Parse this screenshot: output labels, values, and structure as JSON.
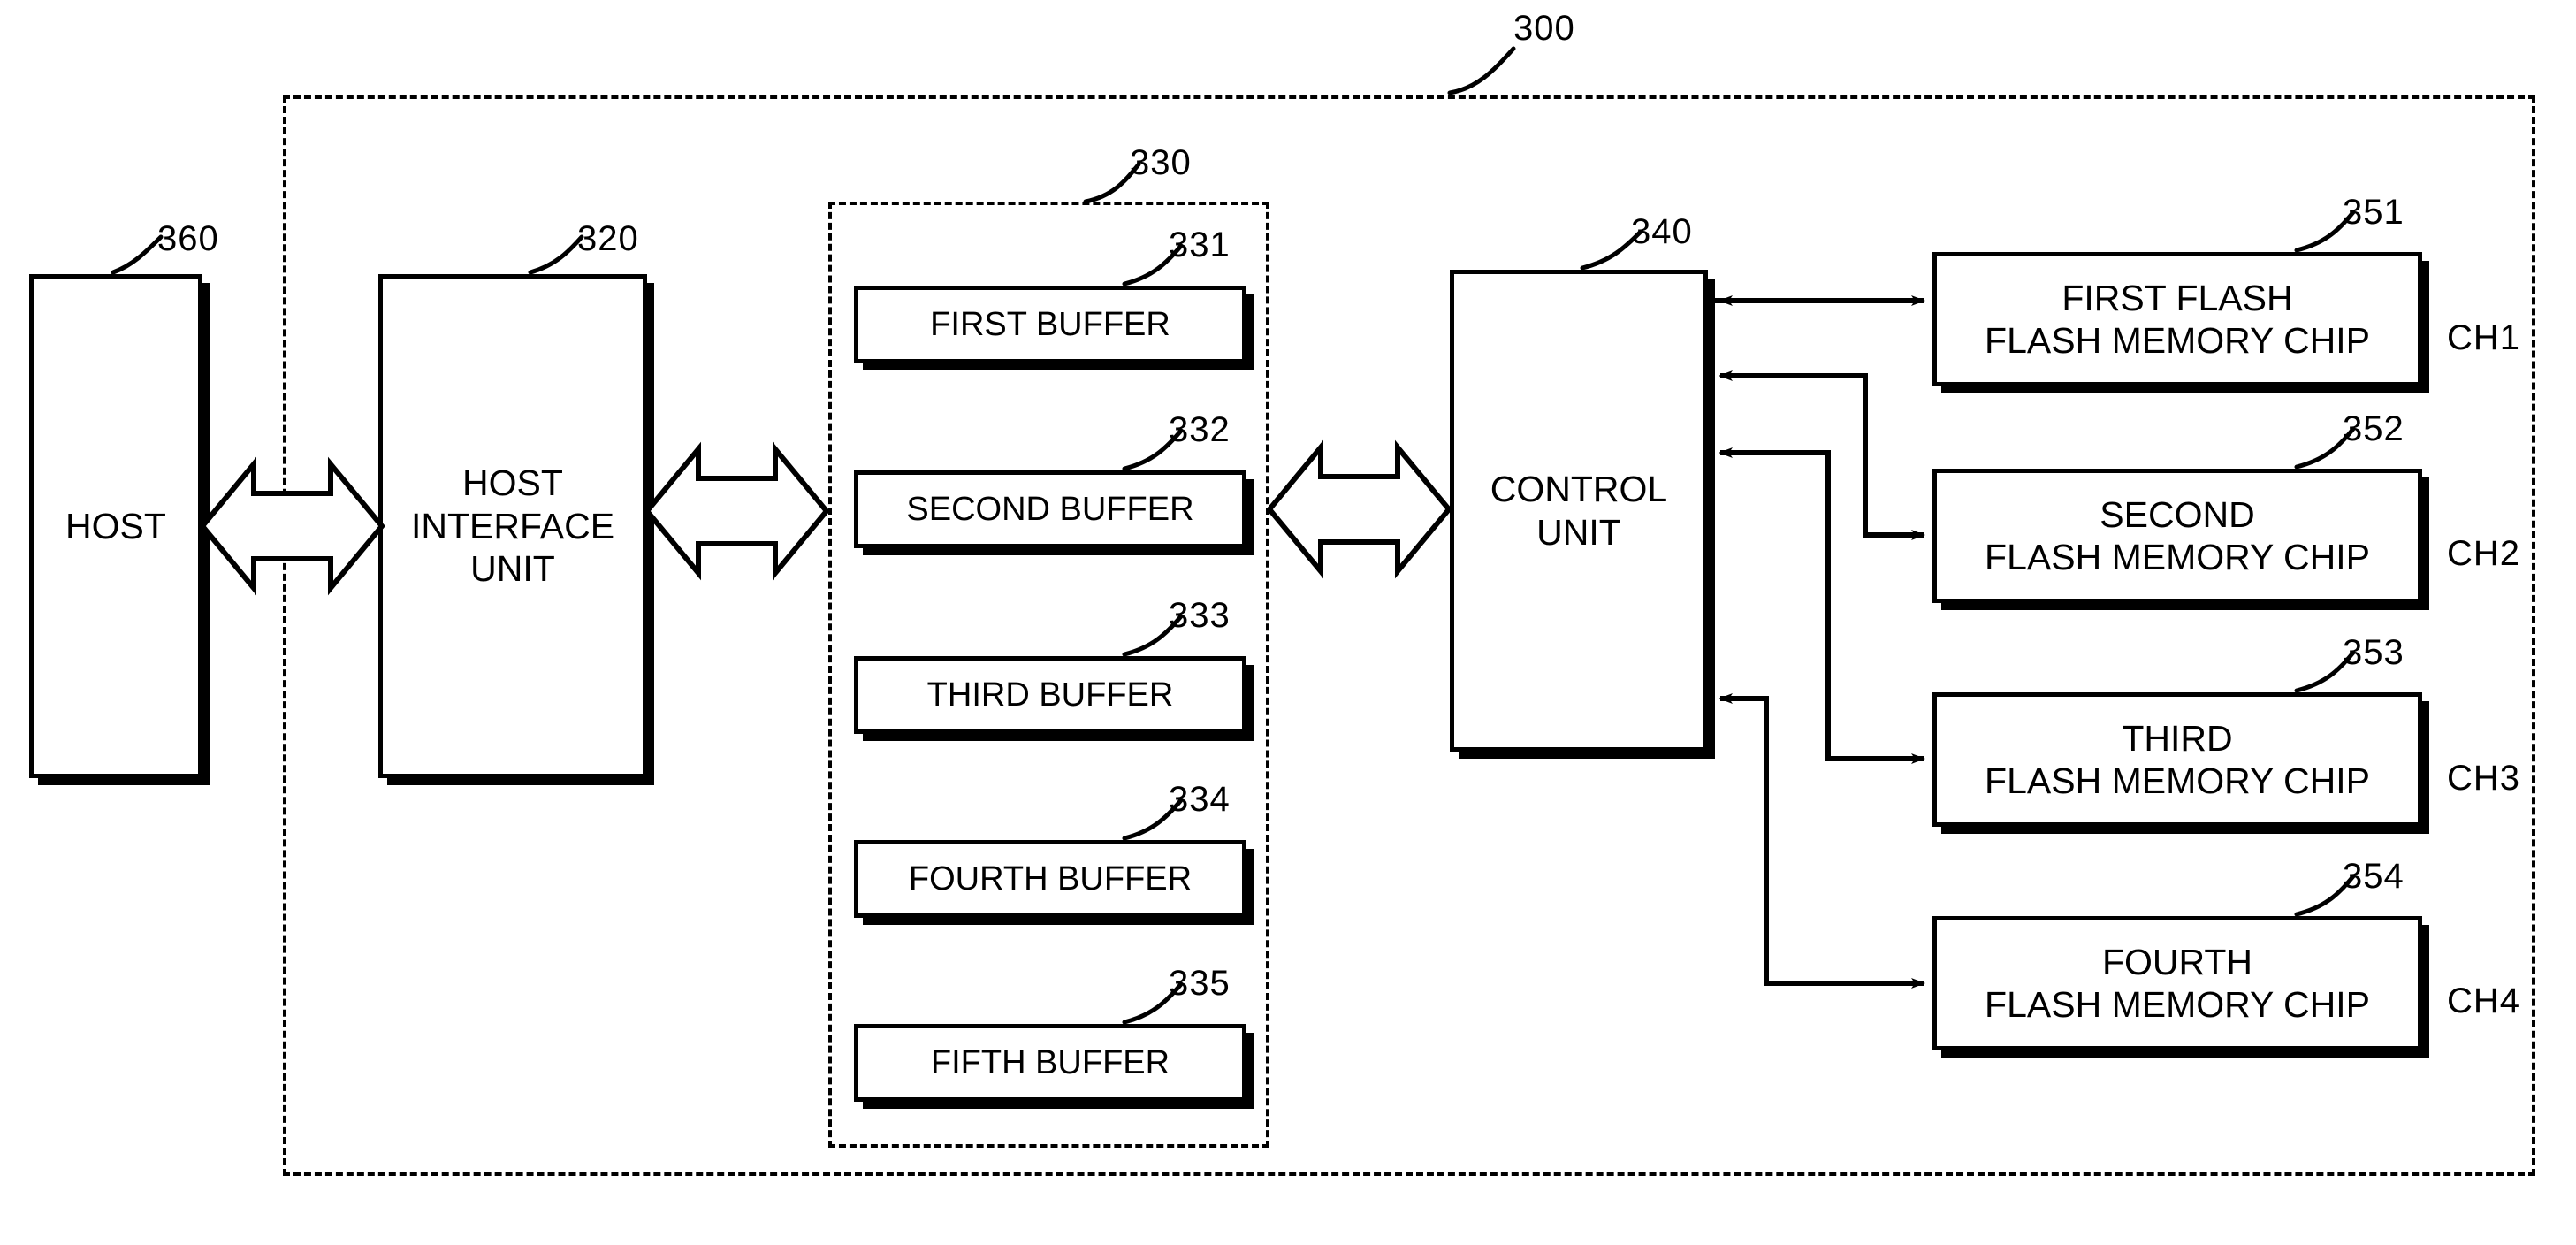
{
  "figure": {
    "device_ref": "300",
    "outer_boundary_style": "dashed"
  },
  "host": {
    "label": "HOST",
    "ref": "360"
  },
  "host_interface": {
    "label": "HOST\nINTERFACE\nUNIT",
    "ref": "320"
  },
  "buffer_group": {
    "ref": "330",
    "buffers": [
      {
        "label": "FIRST BUFFER",
        "ref": "331"
      },
      {
        "label": "SECOND BUFFER",
        "ref": "332"
      },
      {
        "label": "THIRD BUFFER",
        "ref": "333"
      },
      {
        "label": "FOURTH BUFFER",
        "ref": "334"
      },
      {
        "label": "FIFTH BUFFER",
        "ref": "335"
      }
    ]
  },
  "control_unit": {
    "label": "CONTROL\nUNIT",
    "ref": "340"
  },
  "flash_chips": [
    {
      "label": "FIRST FLASH\nFLASH MEMORY CHIP",
      "ref": "351",
      "channel": "CH1"
    },
    {
      "label": "SECOND\nFLASH MEMORY CHIP",
      "ref": "352",
      "channel": "CH2"
    },
    {
      "label": "THIRD\nFLASH MEMORY CHIP",
      "ref": "353",
      "channel": "CH3"
    },
    {
      "label": "FOURTH\nFLASH MEMORY CHIP",
      "ref": "354",
      "channel": "CH4"
    }
  ],
  "colors": {
    "ink": "#000000",
    "paper": "#ffffff"
  }
}
